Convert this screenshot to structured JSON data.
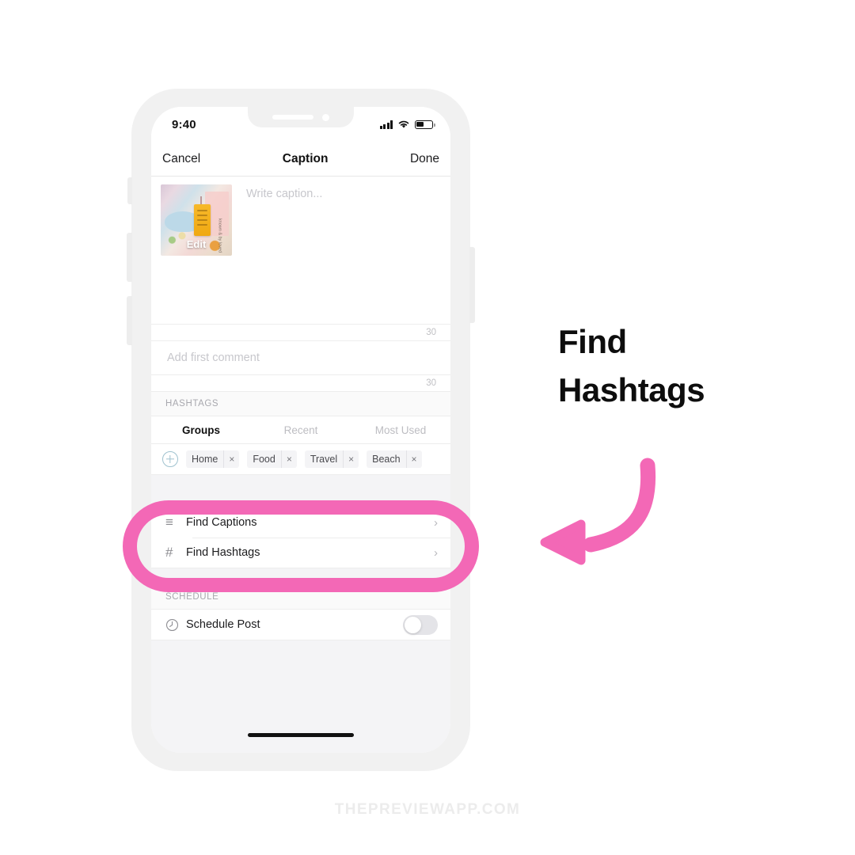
{
  "phone": {
    "status_bar": {
      "time": "9:40",
      "cellular_icon": "signal-bars-icon",
      "wifi_icon": "wifi-icon",
      "battery_icon": "battery-icon"
    },
    "nav": {
      "cancel_label": "Cancel",
      "title": "Caption",
      "done_label": "Done"
    },
    "caption": {
      "placeholder": "Write caption...",
      "thumbnail_edit_label": "Edit",
      "thumbnail_side_text": "known &  by loved",
      "counter": "30"
    },
    "comment": {
      "placeholder": "Add first comment",
      "counter": "30"
    },
    "hashtags": {
      "section_label": "HASHTAGS",
      "tabs": [
        {
          "label": "Groups",
          "active": true
        },
        {
          "label": "Recent",
          "active": false
        },
        {
          "label": "Most Used",
          "active": false
        }
      ],
      "add_group_icon": "plus-circle-icon",
      "chips": [
        {
          "label": "Home",
          "remove": "×"
        },
        {
          "label": "Food",
          "remove": "×"
        },
        {
          "label": "Travel",
          "remove": "×"
        },
        {
          "label": "Beach",
          "remove": "×"
        }
      ]
    },
    "actions": [
      {
        "icon": "lines-icon",
        "glyph": "≡",
        "label": "Find Captions",
        "chevron": "›"
      },
      {
        "icon": "hash-icon",
        "glyph": "#",
        "label": "Find Hashtags",
        "chevron": "›"
      }
    ],
    "schedule": {
      "section_label": "SCHEDULE",
      "icon": "clock-icon",
      "label": "Schedule Post",
      "toggle_state": "off"
    }
  },
  "annotation": {
    "headline_line1": "Find",
    "headline_line2": "Hashtags",
    "arrow_icon": "curved-arrow-left-icon",
    "highlight_color": "#f368b6",
    "headline_color": "#0d0d0d"
  },
  "watermark": {
    "text": "THEPREVIEWAPP.COM"
  }
}
